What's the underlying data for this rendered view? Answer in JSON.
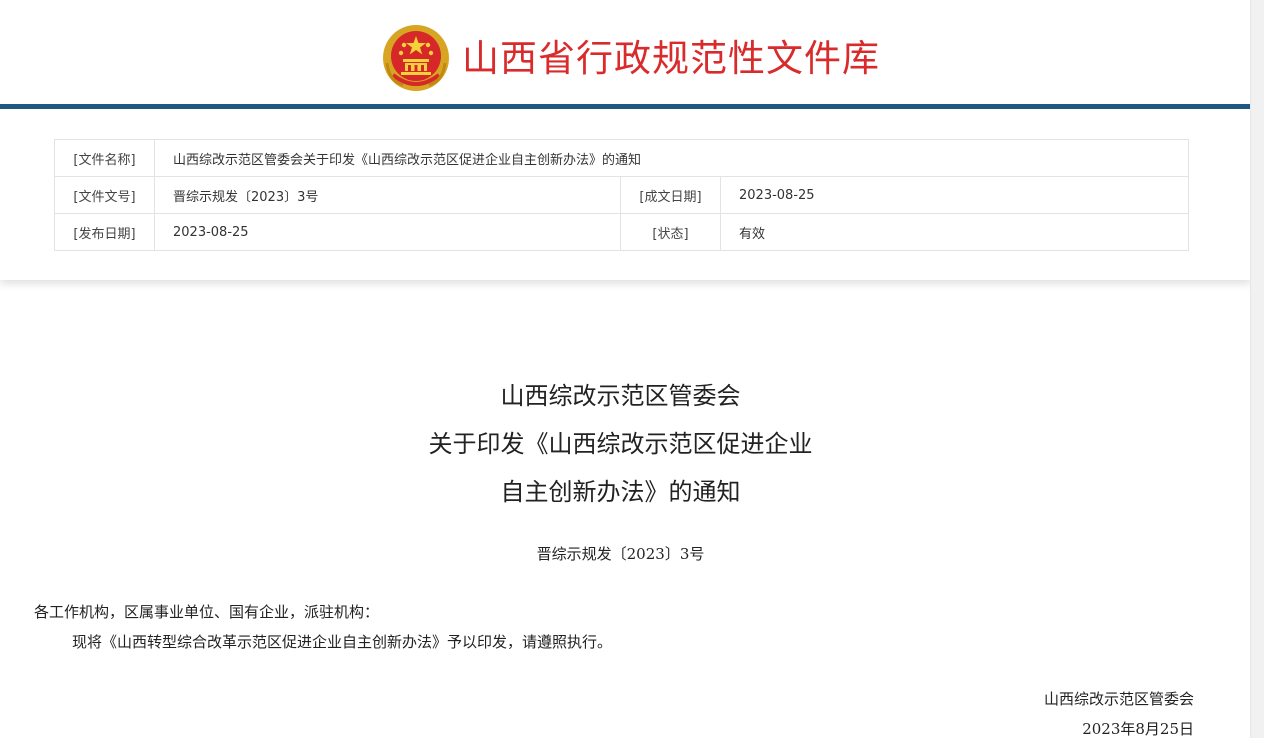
{
  "header": {
    "site_title": "山西省行政规范性文件库",
    "emblem_icon": "national-emblem-icon",
    "brand_red": "#d92b2b",
    "accent_blue": "#205884"
  },
  "meta": {
    "name_label": "[文件名称]",
    "name_value": "山西综改示范区管委会关于印发《山西综改示范区促进企业自主创新办法》的通知",
    "number_label": "[文件文号]",
    "number_value": "晋综示规发〔2023〕3号",
    "written_date_label": "[成文日期]",
    "written_date_value": "2023-08-25",
    "publish_date_label": "[发布日期]",
    "publish_date_value": "2023-08-25",
    "status_label": "[状态]",
    "status_value": "有效"
  },
  "document": {
    "title_lines": [
      "山西综改示范区管委会",
      "关于印发《山西综改示范区促进企业",
      "自主创新办法》的通知"
    ],
    "doc_number": "晋综示规发〔2023〕3号",
    "recipients": "各工作机构，区属事业单位、国有企业，派驻机构：",
    "body": "现将《山西转型综合改革示范区促进企业自主创新办法》予以印发，请遵照执行。",
    "signer": "山西综改示范区管委会",
    "sign_date": "2023年8月25日"
  }
}
